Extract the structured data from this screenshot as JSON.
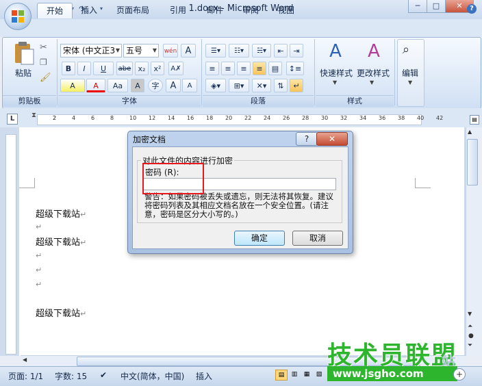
{
  "window": {
    "title": "1.docx - Microsoft Word",
    "controls": [
      "─",
      "□",
      "✕"
    ]
  },
  "quick_access": {
    "save_icon": "save-icon",
    "undo_icon": "undo-icon",
    "redo_icon": "redo-icon",
    "customize_icon": "chevron-down-icon"
  },
  "tabs": [
    "开始",
    "插入",
    "页面布局",
    "引用",
    "邮件",
    "审阅",
    "视图"
  ],
  "ribbon": {
    "clipboard": {
      "paste_label": "粘贴",
      "group_label": "剪贴板"
    },
    "font": {
      "font_name": "宋体 (中文正3",
      "font_size": "五号",
      "group_label": "字体",
      "buttons": [
        "B",
        "I",
        "U",
        "abe",
        "x₂",
        "x²",
        "A",
        "A",
        "Aa",
        "A",
        "字",
        "A",
        "A"
      ]
    },
    "paragraph": {
      "group_label": "段落"
    },
    "styles": {
      "quick_styles_label": "快速样式",
      "change_styles_label": "更改样式",
      "group_label": "样式"
    },
    "editing": {
      "label": "编辑"
    }
  },
  "ruler": {
    "ticks": [
      "2",
      "2",
      "4",
      "6",
      "8",
      "10",
      "12",
      "14",
      "16",
      "18",
      "20",
      "22",
      "24",
      "26",
      "28",
      "30",
      "32",
      "34",
      "36",
      "38",
      "40",
      "42"
    ]
  },
  "document": {
    "lines": [
      {
        "text": "超级下载站",
        "mark": "↵"
      },
      {
        "text": "",
        "mark": "↵"
      },
      {
        "text": "超级下载站",
        "mark": "↵"
      },
      {
        "text": "",
        "mark": "↵"
      },
      {
        "text": "",
        "mark": "↵"
      },
      {
        "text": "",
        "mark": "↵"
      },
      {
        "text": "超级下载站",
        "mark": "↵"
      }
    ]
  },
  "dialog": {
    "title": "加密文档",
    "help_label": "?",
    "close_label": "✕",
    "group_title": "对此文件的内容进行加密",
    "password_label": "密码 (R):",
    "password_value": "",
    "warning": "警告：如果密码被丢失或遗忘，则无法将其恢复。建议将密码列表及其相应文档名放在一个安全位置。(请注意，密码是区分大小写的。)",
    "ok_label": "确定",
    "cancel_label": "取消"
  },
  "status_bar": {
    "page": "页面: 1/1",
    "words": "字数: 15",
    "language": "中文(简体，中国)",
    "mode": "插入"
  },
  "watermark": {
    "main_text": "技术员联盟",
    "url": "www.jsgho.com",
    "small_text": "站"
  },
  "colors": {
    "dialog_highlight": "#e8171b",
    "watermark_green": "#2db52d",
    "ribbon_blue": "#dce8f7"
  }
}
